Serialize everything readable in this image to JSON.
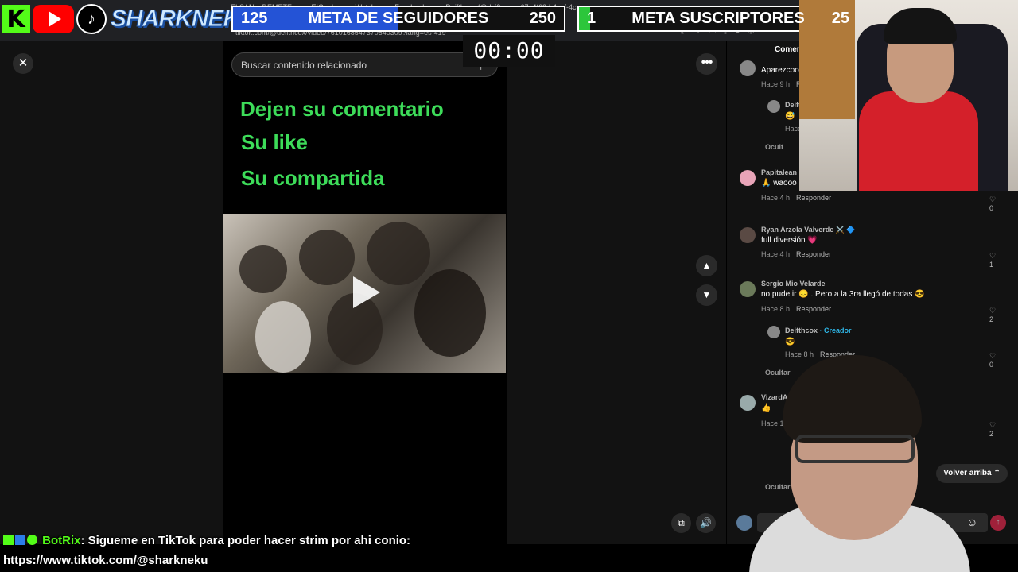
{
  "browser": {
    "tabs": [
      "ELSAN a DEMETE",
      "EIGookiong - Watch",
      "Facebook",
      "Deifthcox (@deif)",
      "67e4f62d-4acf-4c"
    ],
    "url": "tiktok.com/@deifthcox/video/7610168547370540309?lang=es-419"
  },
  "overlay": {
    "brand_name": "SHARKNEKU",
    "follower_goal": {
      "current": "125",
      "title": "META DE SEGUIDORES",
      "target": "250",
      "progress": 0.5,
      "color": "#2453d6"
    },
    "subscriber_goal": {
      "current": "1",
      "title": "META SUSCRIPTORES",
      "target": "25",
      "progress": 0.04,
      "color": "#2cc63b"
    },
    "timer": "00:00",
    "kick_count": "6"
  },
  "viewer": {
    "search_placeholder": "Buscar contenido relacionado",
    "video_lines": [
      "Dejen su comentario",
      "Su like",
      "Su compartida"
    ]
  },
  "comments": {
    "tab_label": "Comen",
    "back_to_top": "Volver arriba",
    "items": [
      {
        "name": "Aparezcoo",
        "body": "",
        "time": "Hace 9 h",
        "reply": "R"
      },
      {
        "name": "Deifth",
        "body": "😅",
        "time": "Hace",
        "reply": ""
      },
      {
        "name": "Papitalean",
        "body": "🙏 waooo",
        "time": "Hace 4 h",
        "reply": "Responder",
        "likes": "0"
      },
      {
        "name": "Ryan Arzola Valverde ⚔️ 🔷",
        "body": "full diversión 💗",
        "time": "Hace 4 h",
        "reply": "Responder",
        "likes": "1"
      },
      {
        "name": "Sergio Mio Velarde",
        "body": "no pude ir 😞 . Pero a la 3ra llegó de todas 😎",
        "time": "Hace 8 h",
        "reply": "Responder",
        "likes": "2"
      },
      {
        "name": "Deifthcox",
        "creator": "· Creador",
        "body": "😎",
        "time": "Hace 8 h",
        "reply": "Responder",
        "likes": "0"
      },
      {
        "name": "VizardA",
        "body": "👍",
        "time": "Hace 1",
        "reply": "",
        "likes": "2"
      }
    ],
    "hide_labels": [
      "Ocult",
      "Ocultar",
      "Ocultar"
    ]
  },
  "chat": {
    "user": "BotRix",
    "message": ": Sigueme en TikTok para poder hacer strim por ahi conio:",
    "link": "https://www.tiktok.com/@sharkneku"
  }
}
